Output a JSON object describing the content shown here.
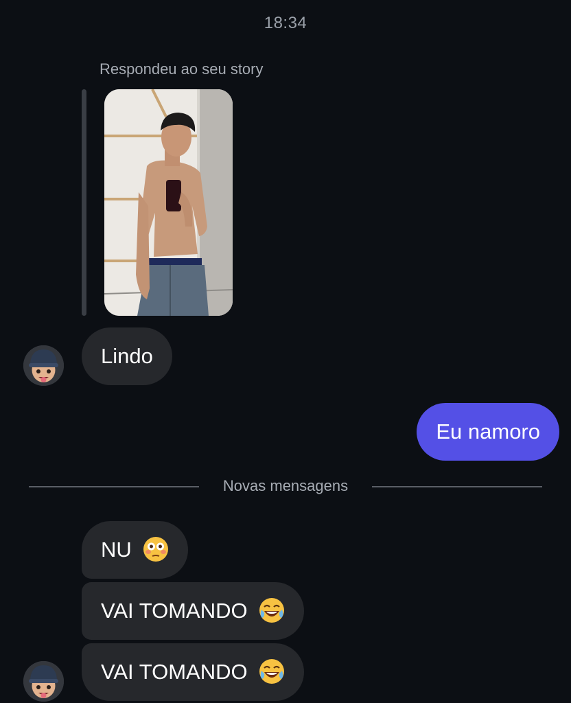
{
  "header": {
    "time": "18:34"
  },
  "story_reply": {
    "label": "Respondeu ao seu story",
    "image_icon": "story-photo"
  },
  "messages": [
    {
      "direction": "incoming",
      "text": "Lindo"
    },
    {
      "direction": "outgoing",
      "text": "Eu namoro"
    }
  ],
  "divider": {
    "label": "Novas mensagens"
  },
  "new_messages": [
    {
      "direction": "incoming",
      "text": "NU",
      "emoji": "flushed-face-emoji"
    },
    {
      "direction": "incoming",
      "text": "VAI TOMANDO",
      "emoji": "tears-of-joy-emoji"
    },
    {
      "direction": "incoming",
      "text": "VAI TOMANDO",
      "emoji": "tears-of-joy-emoji"
    }
  ],
  "colors": {
    "background": "#0c0f14",
    "incoming_bubble": "#26282c",
    "outgoing_bubble": "#5450e6",
    "muted_text": "#a7acb4"
  }
}
